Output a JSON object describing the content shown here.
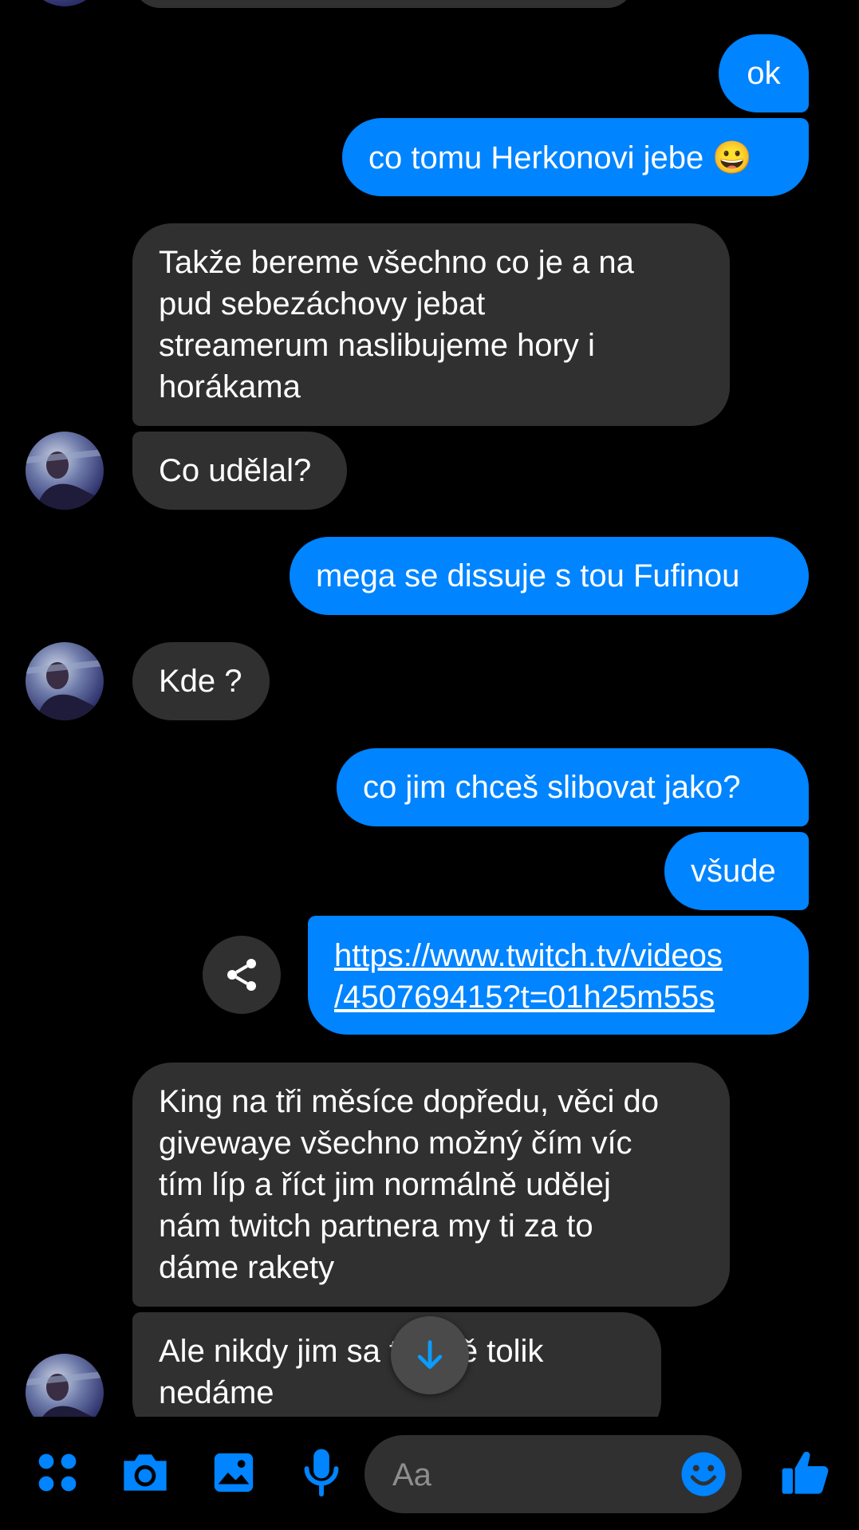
{
  "colors": {
    "accent": "#0084ff",
    "incoming_bubble": "#303030",
    "background": "#000000"
  },
  "messages": [
    {
      "direction": "out",
      "text": "ok"
    },
    {
      "direction": "out",
      "text": "co tomu Herkonovi jebe 😀"
    },
    {
      "direction": "in",
      "text": "Takže bereme všechno co je a na pud sebezáchovy jebat streamerum naslibujeme hory i horákama"
    },
    {
      "direction": "in",
      "text": "Co udělal?"
    },
    {
      "direction": "out",
      "text": "mega se dissuje s tou Fufinou"
    },
    {
      "direction": "in",
      "text": "Kde ?"
    },
    {
      "direction": "out",
      "text": "co jim chceš slibovat jako?"
    },
    {
      "direction": "out",
      "text": "všude"
    },
    {
      "direction": "out",
      "text": "https://www.twitch.tv/videos/450769415?t=01h25m55s"
    },
    {
      "direction": "in",
      "text": "King na tři měsíce dopředu, věci do givewaye všechno možný čím víc tím líp a říct jim normálně udělej nám twitch partnera my ti za to dáme rakety"
    },
    {
      "direction": "in",
      "text": "Ale nikdy jim sa… třejmě tolik nedáme"
    }
  ],
  "composer": {
    "placeholder": "Aa",
    "icons": [
      "apps-icon",
      "camera-icon",
      "gallery-icon",
      "microphone-icon",
      "emoji-icon",
      "thumbs-up-icon"
    ]
  },
  "message_text": {
    "m3": "Takže bereme všechno co je a na\npud sebezáchovy jebat\nstreamerum naslibujeme hory i\nhorákama",
    "m9": "https://www.twitch.tv/videos\n/450769415?t=01h25m55s",
    "m10": "King na tři měsíce dopředu, věci do\ngivewaye všechno možný čím víc\ntím líp a říct jim normálně udělej\nnám twitch partnera my ti za to\ndáme rakety",
    "m11": "Ale nikdy jim sa    třejmě tolik\nnedáme"
  }
}
